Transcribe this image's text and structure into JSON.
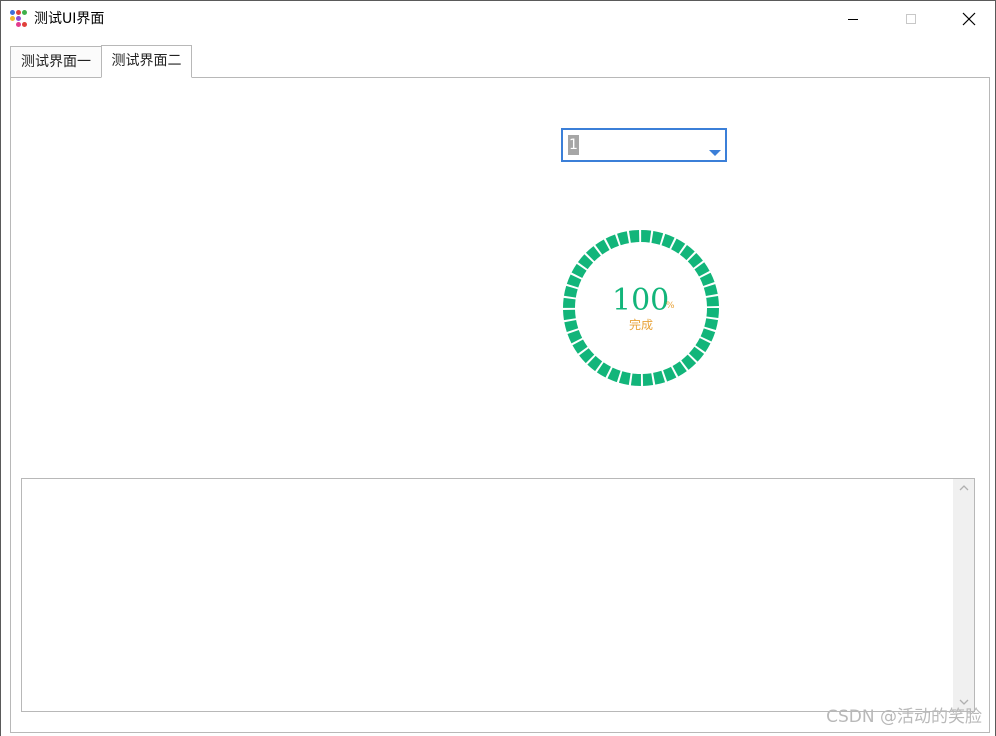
{
  "window": {
    "title": "测试UI界面"
  },
  "tabs": [
    {
      "label": "测试界面一",
      "selected": false
    },
    {
      "label": "测试界面二",
      "selected": true
    }
  ],
  "combo": {
    "value": "1",
    "accent": "#3b7fd8"
  },
  "progress": {
    "value": "100",
    "percent": 100,
    "unit": "%",
    "label": "完成",
    "ring_color": "#12b57a",
    "text_color": "#12b57a",
    "label_color": "#e8a33a"
  },
  "textarea": {
    "value": ""
  },
  "watermark": "CSDN @活动的笑脸",
  "icons": {
    "minimize": "minimize-icon",
    "maximize": "maximize-icon",
    "close": "close-icon",
    "scroll_up": "chevron-up-icon",
    "scroll_down": "chevron-down-icon"
  }
}
